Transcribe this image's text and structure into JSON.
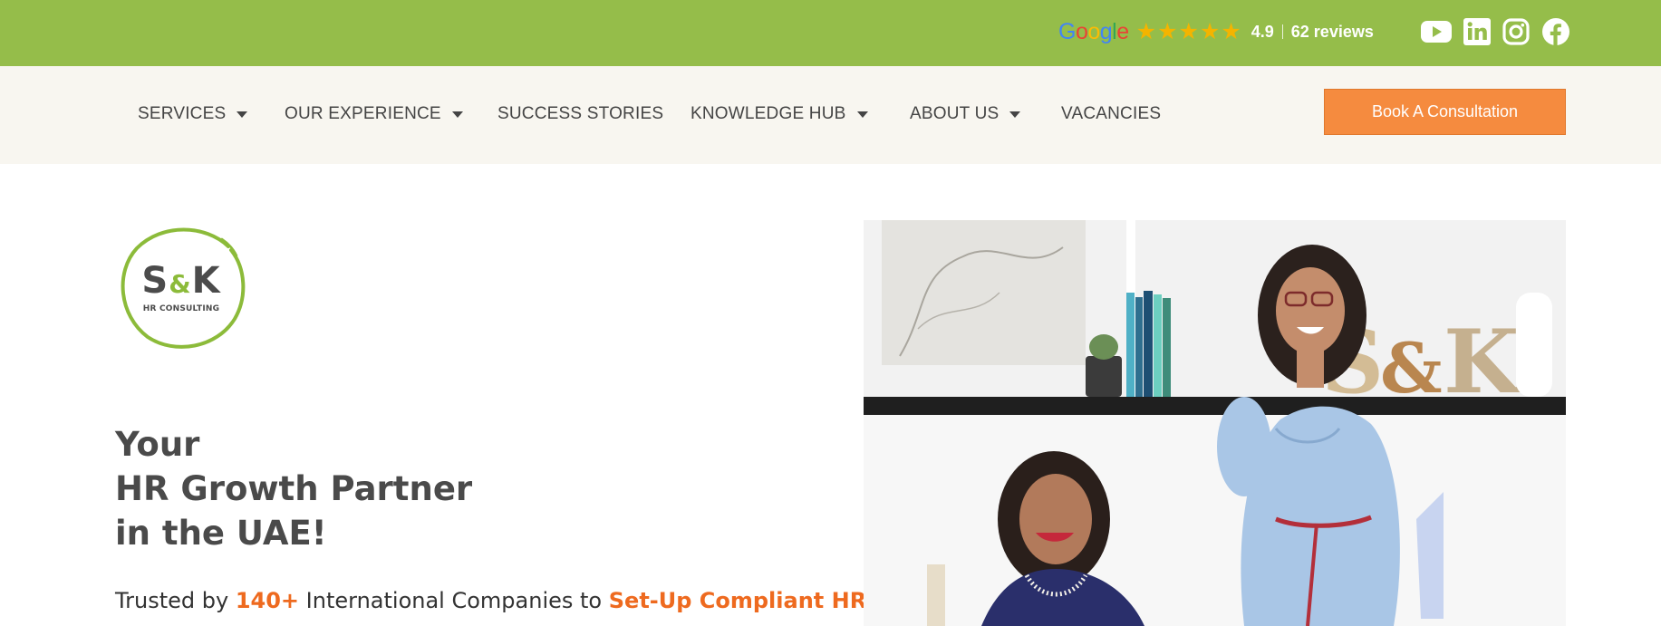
{
  "topbar": {
    "google_logo": "Google",
    "star_count": 5,
    "rating": "4.9",
    "reviews": "62 reviews",
    "social": [
      "youtube-icon",
      "linkedin-icon",
      "instagram-icon",
      "facebook-icon"
    ]
  },
  "nav": {
    "services": "SERVICES",
    "experience": "OUR EXPERIENCE",
    "success": "SUCCESS STORIES",
    "hub": "KNOWLEDGE HUB",
    "about": "ABOUT US",
    "vacancies": "VACANCIES",
    "cta": "Book A Consultation"
  },
  "logo": {
    "main": "S&K",
    "sub": "HR CONSULTING"
  },
  "hero": {
    "line1": "Your",
    "line2": "HR Growth Partner",
    "line3": "in the UAE!",
    "trusted_pre": "Trusted by ",
    "trusted_num": "140+",
    "trusted_mid": " International Companies to ",
    "trusted_hl": "Set-Up Compliant HR"
  },
  "colors": {
    "topbar": "#95bd4a",
    "navbar": "#f8f6f0",
    "cta": "#f58b3f",
    "accent_orange": "#ee6a1f",
    "logo_green": "#8cbb3a"
  }
}
